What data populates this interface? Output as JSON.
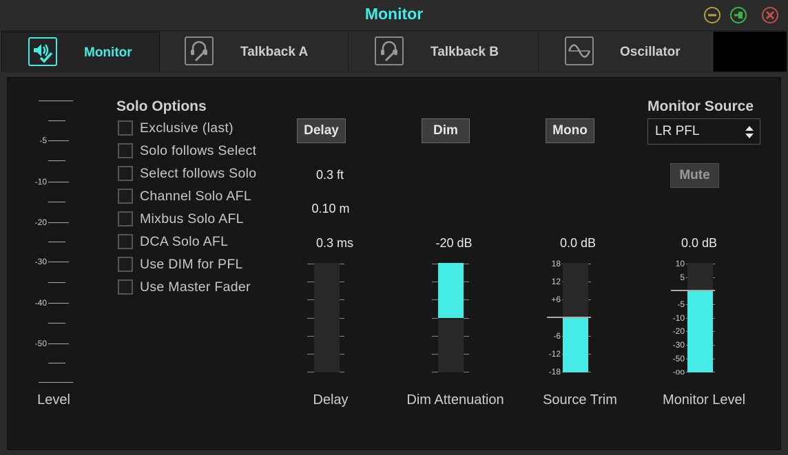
{
  "window": {
    "title": "Monitor"
  },
  "tabs": [
    {
      "label": "Monitor",
      "icon": "speaker-check-icon",
      "active": true
    },
    {
      "label": "Talkback A",
      "icon": "headset-mic-icon",
      "active": false
    },
    {
      "label": "Talkback B",
      "icon": "headset-mic-icon",
      "active": false
    },
    {
      "label": "Oscillator",
      "icon": "sine-wave-icon",
      "active": false
    }
  ],
  "level_meter": {
    "labels": [
      "-5",
      "-10",
      "-20",
      "-30",
      "-40",
      "-50"
    ],
    "title": "Level"
  },
  "solo_options": {
    "title": "Solo Options",
    "items": [
      {
        "label": "Exclusive (last)",
        "checked": false
      },
      {
        "label": "Solo follows Select",
        "checked": false
      },
      {
        "label": "Select follows Solo",
        "checked": false
      },
      {
        "label": "Channel Solo AFL",
        "checked": false
      },
      {
        "label": "Mixbus Solo AFL",
        "checked": false
      },
      {
        "label": "DCA Solo AFL",
        "checked": false
      },
      {
        "label": "Use DIM for PFL",
        "checked": false
      },
      {
        "label": "Use Master Fader",
        "checked": false
      }
    ]
  },
  "delay": {
    "button": "Delay",
    "value_ft": "0.3 ft",
    "value_m": "0.10 m",
    "value_ms": "0.3 ms",
    "title": "Delay"
  },
  "dim": {
    "button": "Dim",
    "value": "-20 dB",
    "title": "Dim Attenuation",
    "fill_fraction": 0.5
  },
  "source_trim": {
    "button": "Mono",
    "value": "0.0 dB",
    "title": "Source Trim",
    "scale": [
      "18",
      "12",
      "+6",
      "-6",
      "-12",
      "-18"
    ],
    "fill_fraction": 0.5
  },
  "monitor": {
    "source_title": "Monitor Source",
    "source_value": "LR PFL",
    "mute_button": "Mute",
    "value": "0.0 dB",
    "title": "Monitor Level",
    "scale": [
      "10",
      "5",
      "-5",
      "-10",
      "-20",
      "-30",
      "-50",
      "-oo"
    ],
    "fill_fraction": 0.75
  },
  "colors": {
    "accent": "#45ebe5",
    "background": "#171717",
    "chrome": "#2c2c2c"
  }
}
